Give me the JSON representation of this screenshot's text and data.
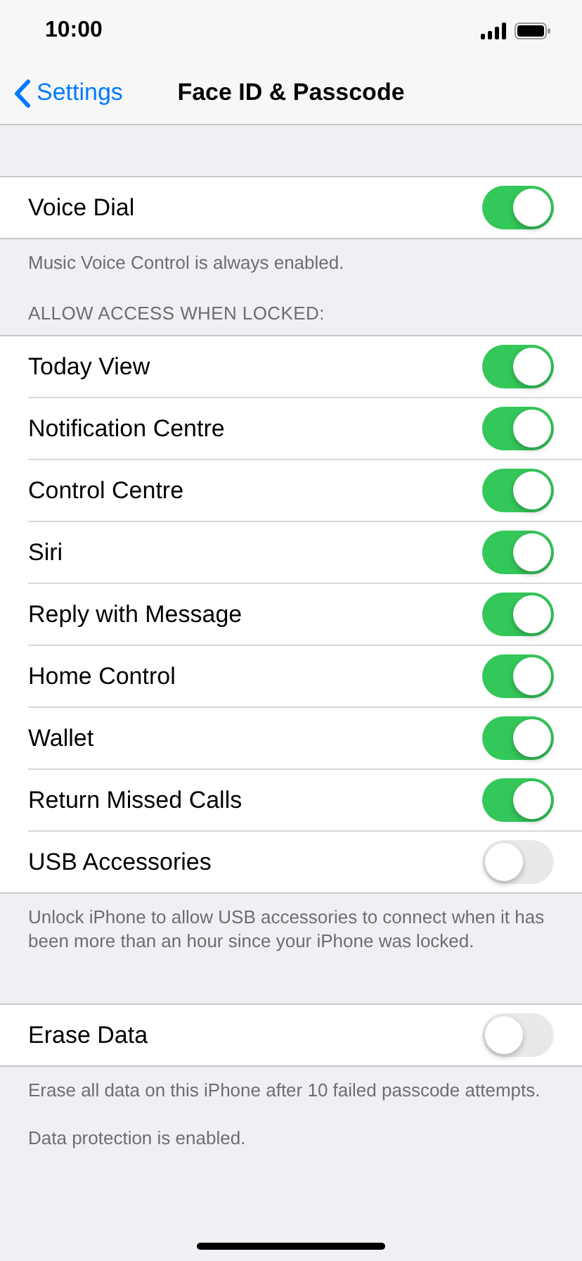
{
  "status_bar": {
    "time": "10:00"
  },
  "nav": {
    "back": "Settings",
    "title": "Face ID & Passcode"
  },
  "sections": [
    {
      "rows": [
        {
          "label": "Voice Dial",
          "on": true
        }
      ],
      "footer": [
        "Music Voice Control is always enabled."
      ]
    },
    {
      "header": "ALLOW ACCESS WHEN LOCKED:",
      "rows": [
        {
          "label": "Today View",
          "on": true
        },
        {
          "label": "Notification Centre",
          "on": true
        },
        {
          "label": "Control Centre",
          "on": true
        },
        {
          "label": "Siri",
          "on": true
        },
        {
          "label": "Reply with Message",
          "on": true
        },
        {
          "label": "Home Control",
          "on": true
        },
        {
          "label": "Wallet",
          "on": true
        },
        {
          "label": "Return Missed Calls",
          "on": true
        },
        {
          "label": "USB Accessories",
          "on": false
        }
      ],
      "footer": [
        "Unlock iPhone to allow USB accessories to connect when it has been more than an hour since your iPhone was locked."
      ]
    },
    {
      "rows": [
        {
          "label": "Erase Data",
          "on": false
        }
      ],
      "footer": [
        "Erase all data on this iPhone after 10 failed passcode attempts.",
        "Data protection is enabled."
      ]
    }
  ]
}
